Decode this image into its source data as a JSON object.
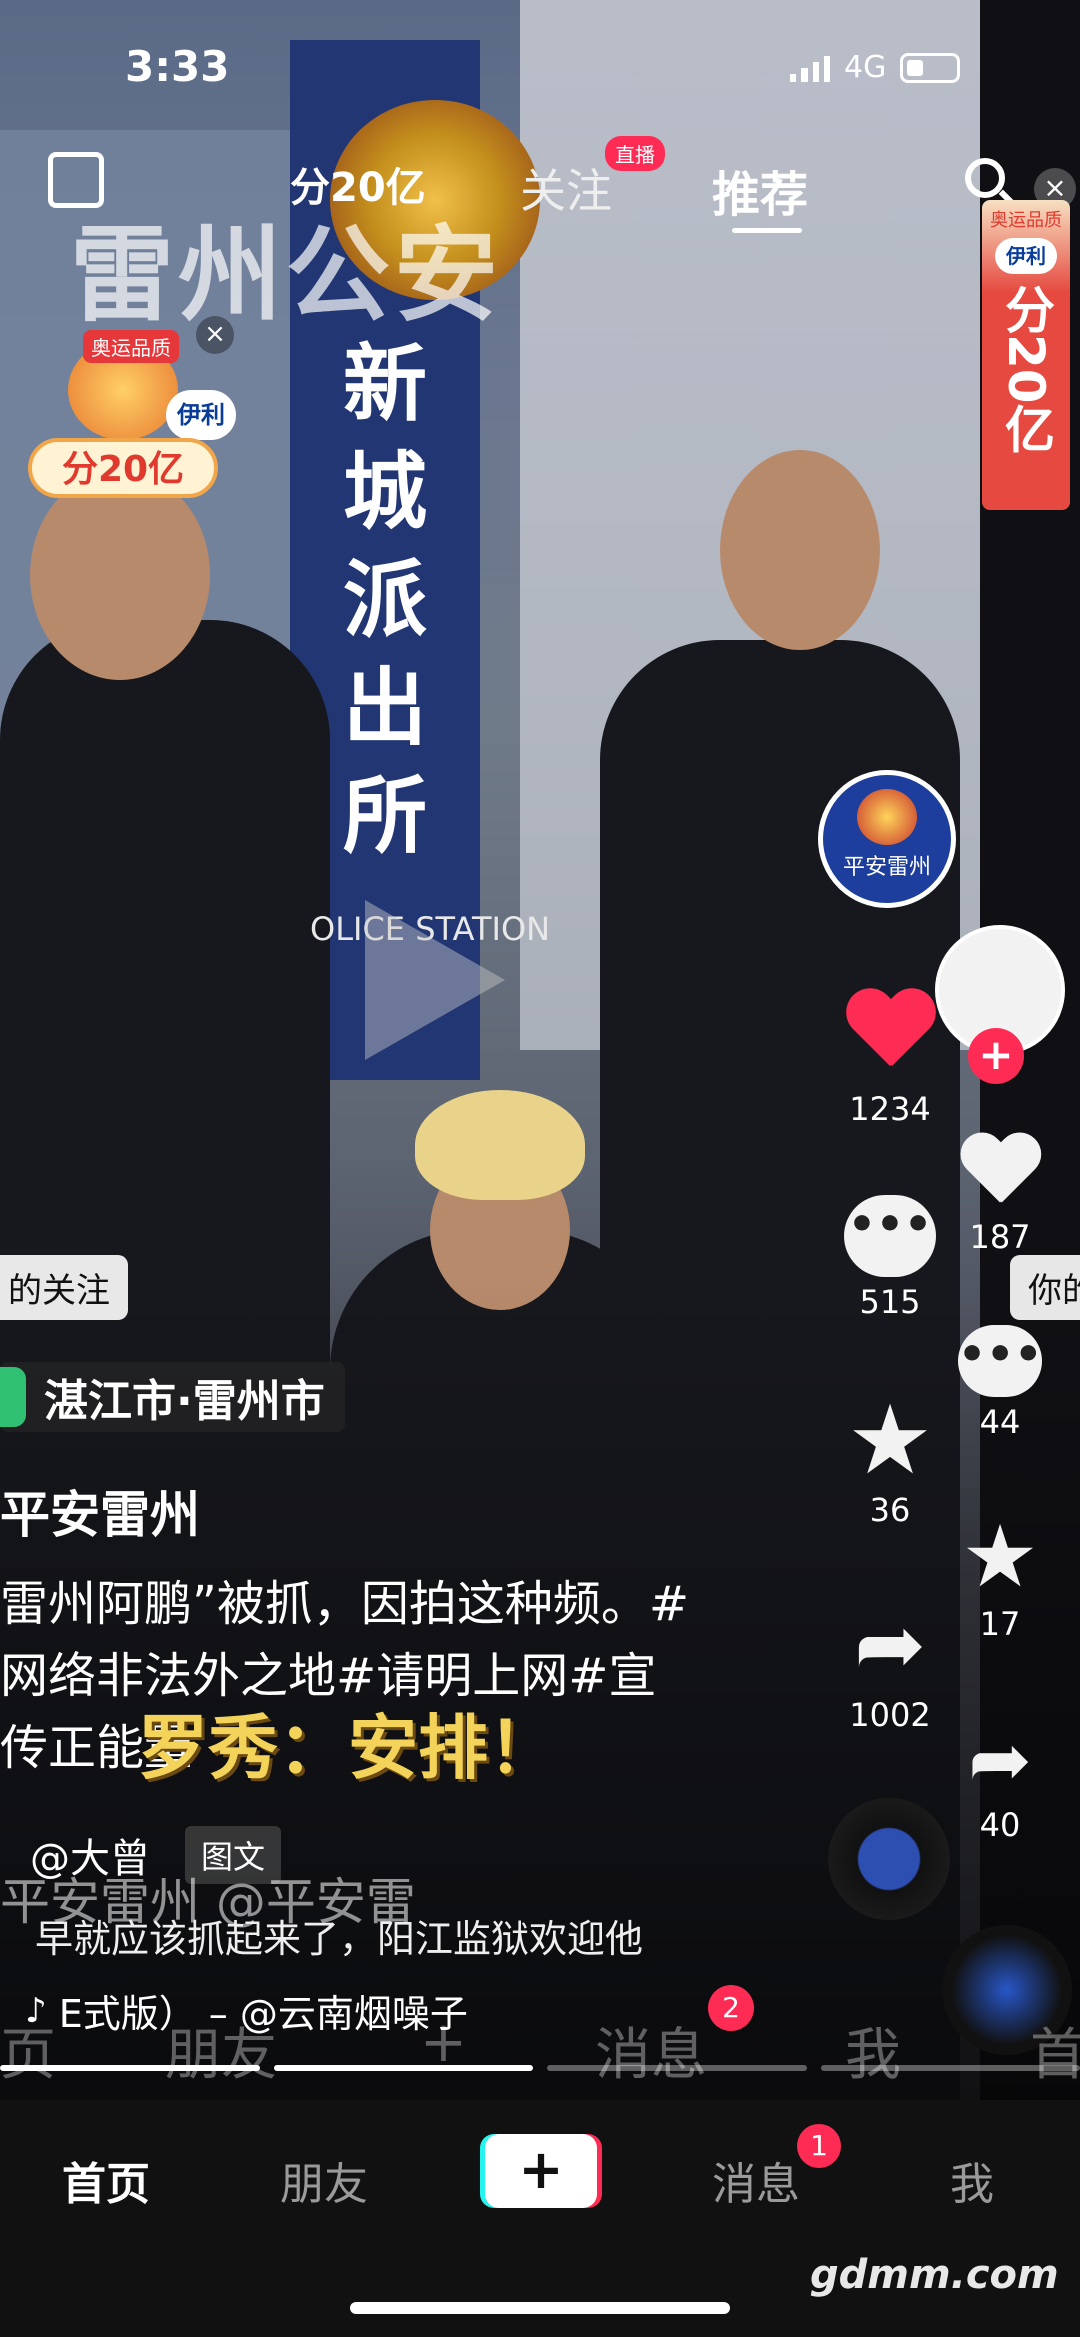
{
  "status_bar": {
    "time": "3:33",
    "network": "4G"
  },
  "top_nav": {
    "prize": "分20亿",
    "follow": "关注",
    "live_badge": "直播",
    "recommend": "推荐"
  },
  "video": {
    "overlay_title": "雷州公安",
    "banner_text": [
      "新",
      "城",
      "派",
      "出",
      "所"
    ],
    "station_text": "OLICE STATION",
    "subtitle": "罗秀：安排！"
  },
  "promo": {
    "tag": "奥运品质",
    "brand": "伊利",
    "amount": "分20亿"
  },
  "side_promo": {
    "tag": "奥运品质",
    "brand": "伊利",
    "amount": "分20亿"
  },
  "creator": {
    "avatar_name": "平安雷州"
  },
  "actions": {
    "likes": "1234",
    "comments": "515",
    "favorites": "36",
    "shares": "1002"
  },
  "ghost_actions": {
    "likes": "187",
    "comments": "44",
    "favorites": "17",
    "shares": "40"
  },
  "post": {
    "follow_hint": "的关注",
    "follow_hint_right": "你的",
    "location": "湛江市·雷州市",
    "author": "平安雷州",
    "caption": "雷州阿鹏”被抓，因拍这种频。#网络非法外之地#请明上网#宣传正能量",
    "mention": "@大曾",
    "chip": "图文",
    "ghost_line": "平安雷州  @平安雷",
    "comment": "早就应该抓起来了，阳江监狱欢迎他",
    "music": "E式版）  –  @云南烟噪子"
  },
  "ghost_nav": {
    "items": [
      "页",
      "朋友",
      "+",
      "消息",
      "我",
      "首"
    ],
    "badge": "2"
  },
  "tab_bar": {
    "home": "首页",
    "friends": "朋友",
    "plus": "+",
    "messages": "消息",
    "messages_badge": "1",
    "me": "我"
  },
  "watermark": "gdmm.com"
}
